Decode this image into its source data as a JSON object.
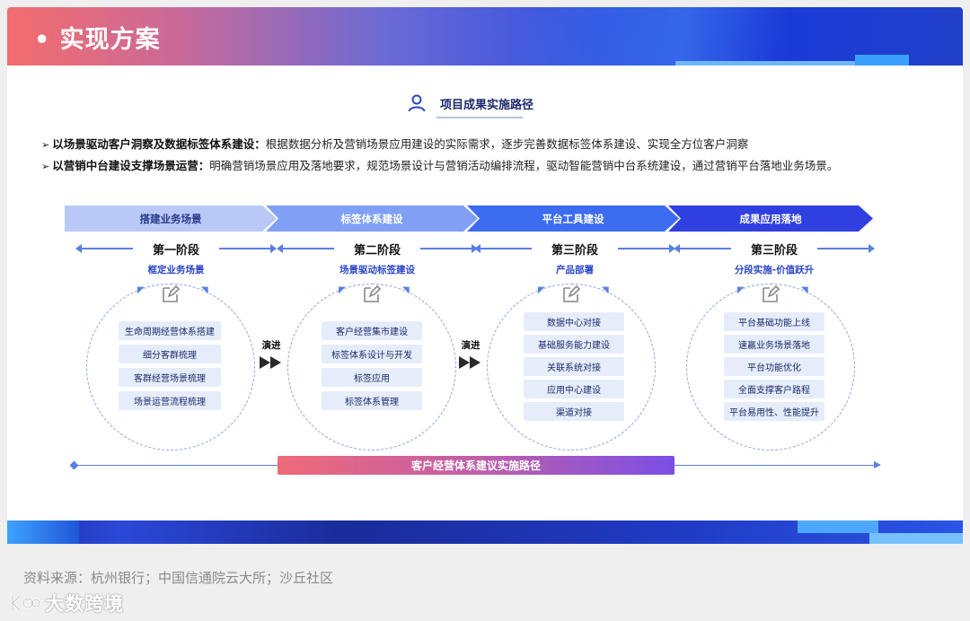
{
  "header": {
    "title": "• 实现方案"
  },
  "subtitle": "项目成果实施路径",
  "bullets": [
    {
      "marker": "➢",
      "bold": "以场景驱动客户洞察及数据标签体系建设：",
      "text": "根据数据分析及营销场景应用建设的实际需求，逐步完善数据标签体系建设、实现全方位客户洞察"
    },
    {
      "marker": "➢",
      "bold": "以营销中台建设支撑场景运营：",
      "text": "明确营销场景应用及落地要求，规范场景设计与营销活动编排流程，驱动智能营销中台系统建设，通过营销平台落地业务场景。"
    }
  ],
  "chevrons": [
    "搭建业务场景",
    "标签体系建设",
    "平台工具建设",
    "成果应用落地"
  ],
  "stages": [
    {
      "title": "第一阶段",
      "subtitle": "框定业务场景",
      "items": [
        "生命周期经营体系搭建",
        "细分客群梳理",
        "客群经营场景梳理",
        "场景运营流程梳理"
      ]
    },
    {
      "title": "第二阶段",
      "subtitle": "场景驱动标签建设",
      "items": [
        "客户经营集市建设",
        "标签体系设计与开发",
        "标签应用",
        "标签体系管理"
      ]
    },
    {
      "title": "第三阶段",
      "subtitle": "产品部署",
      "items": [
        "数据中心对接",
        "基础服务能力建设",
        "关联系统对接",
        "应用中心建设",
        "渠道对接"
      ]
    },
    {
      "title": "第三阶段",
      "subtitle": "分段实施-价值跃升",
      "items": [
        "平台基础功能上线",
        "速赢业务场景落地",
        "平台功能优化",
        "全面支撑客户路程",
        "平台易用性、性能提升"
      ]
    }
  ],
  "evolve_label": "演进",
  "bottom_bar": "客户经营体系建议实施路径",
  "source": "资料来源：杭州银行；中国信通院云大所；沙丘社区",
  "watermark": "大数跨境",
  "colors": {
    "chevron1": "#b9c8f7",
    "chevron2": "#7fa0f5",
    "chevron3": "#3c6cf0",
    "chevron4": "#2f3fe0",
    "accent": "#2a45c8"
  }
}
